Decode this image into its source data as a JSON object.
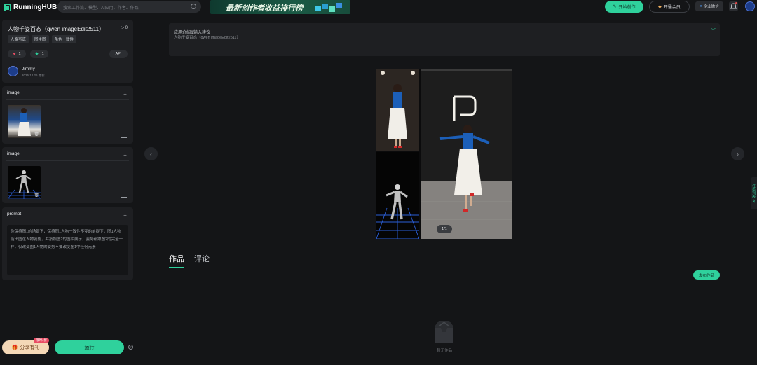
{
  "header": {
    "logo_text": "RunningHUB",
    "search_placeholder": "搜索工作流、模型、AI应用、作者、作品",
    "banner_text": "最新创作者收益排行榜",
    "start_button": "开始创作",
    "vip_button": "开通会员",
    "wechat_button": "企业微信"
  },
  "workflow": {
    "title": "人物千姿百态（qwen imageEdit2511）",
    "plays": "0",
    "tags": [
      "人像写真",
      "图生图",
      "角色一致性"
    ],
    "likes": "1",
    "stars": "1",
    "api_label": "API",
    "author": "Jimmy",
    "updated": "2025.12.26 更新"
  },
  "inputs": {
    "image1_label": "image",
    "image2_label": "image",
    "prompt_label": "prompt",
    "prompt_text": "你保持图1的场景下，保持图1人物一致性不变的前提下，图1人物能出图这人物姿势，并按照图2的图拍展示，姿势都跟图2的完全一样，仅改变图1人物的姿势不要改变图1中任何元素"
  },
  "actions": {
    "share_label": "分享有礼",
    "share_badge": "限时4折",
    "run_label": "运行",
    "help": "?"
  },
  "info": {
    "title": "应用介绍&输入建议",
    "subtitle": "人物千姿百态（qwen imageEdit2511）"
  },
  "gallery": {
    "counter": "1/1"
  },
  "tabs": {
    "works": "作品",
    "comments": "评论",
    "publish": "发布作品"
  },
  "empty": {
    "text": "暂无作品"
  },
  "side_tab": "任务列表 ≪",
  "colors": {
    "accent": "#2fd19c",
    "background": "#141517",
    "panel": "#1e1f22"
  }
}
